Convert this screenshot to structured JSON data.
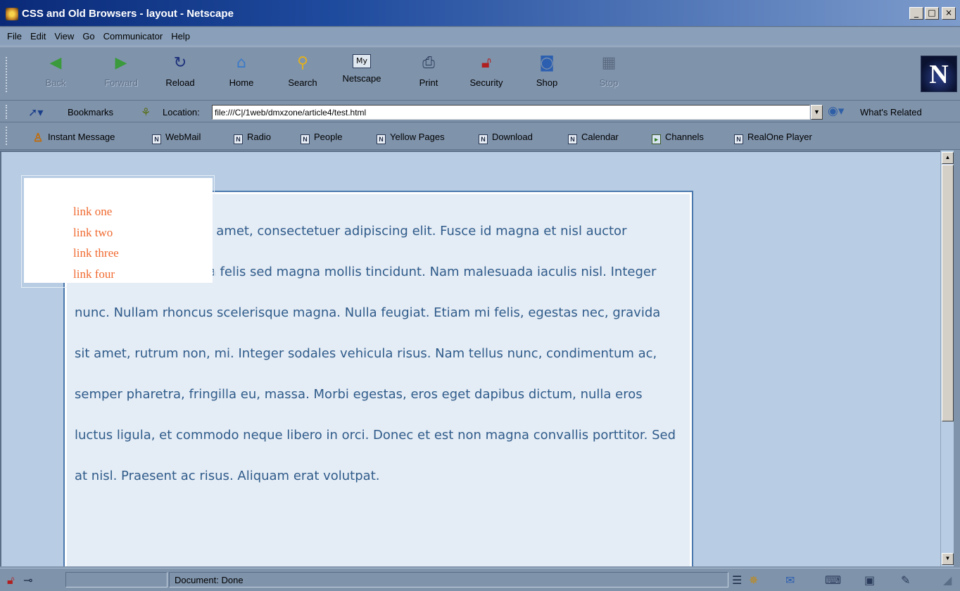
{
  "window": {
    "title": "CSS and Old Browsers - layout - Netscape",
    "controls": {
      "minimize": "_",
      "maximize": "□",
      "close": "×"
    }
  },
  "menu": [
    "File",
    "Edit",
    "View",
    "Go",
    "Communicator",
    "Help"
  ],
  "navigation": {
    "buttons": [
      {
        "label": "Back",
        "icon": "back-arrow-icon",
        "enabled": false
      },
      {
        "label": "Forward",
        "icon": "forward-arrow-icon",
        "enabled": false
      },
      {
        "label": "Reload",
        "icon": "reload-icon",
        "enabled": true
      },
      {
        "label": "Home",
        "icon": "home-icon",
        "enabled": true
      },
      {
        "label": "Search",
        "icon": "search-icon",
        "enabled": true
      },
      {
        "label": "Netscape",
        "icon": "my-netscape-icon",
        "enabled": true
      },
      {
        "label": "Print",
        "icon": "print-icon",
        "enabled": true
      },
      {
        "label": "Security",
        "icon": "security-lock-icon",
        "enabled": true
      },
      {
        "label": "Shop",
        "icon": "shop-icon",
        "enabled": true
      },
      {
        "label": "Stop",
        "icon": "stop-icon",
        "enabled": false
      }
    ],
    "logo": "N"
  },
  "location": {
    "bookmarks_label": "Bookmarks",
    "location_label": "Location:",
    "url": "file:///C|/1web/dmxzone/article4/test.html",
    "related_label": "What's Related"
  },
  "personal_toolbar": [
    {
      "label": "Instant Message",
      "icon": "instant-message-icon"
    },
    {
      "label": "WebMail",
      "icon": "bookmark-page-icon"
    },
    {
      "label": "Radio",
      "icon": "bookmark-page-icon"
    },
    {
      "label": "People",
      "icon": "bookmark-page-icon"
    },
    {
      "label": "Yellow Pages",
      "icon": "bookmark-page-icon"
    },
    {
      "label": "Download",
      "icon": "bookmark-page-icon"
    },
    {
      "label": "Calendar",
      "icon": "bookmark-page-icon"
    },
    {
      "label": "Channels",
      "icon": "channels-icon"
    },
    {
      "label": "RealOne Player",
      "icon": "bookmark-page-icon"
    }
  ],
  "page": {
    "nav_links": [
      "link one",
      "link two",
      "link three",
      "link four"
    ],
    "paragraph": "Lorem ipsum dolor sit amet, consectetuer adipiscing elit. Fusce id magna et nisl auctor malesuada. Aliquam a felis sed magna mollis tincidunt. Nam malesuada iaculis nisl. Integer nunc. Nullam rhoncus scelerisque magna. Nulla feugiat. Etiam mi felis, egestas nec, gravida sit amet, rutrum non, mi. Integer sodales vehicula risus. Nam tellus nunc, condimentum ac, semper pharetra, fringilla eu, massa. Morbi egestas, eros eget dapibus dictum, nulla eros luctus ligula, et commodo neque libero in orci. Donec et est non magna convallis porttitor. Sed at nisl. Praesent ac risus. Aliquam erat volutpat.",
    "link_color": "#f06a30",
    "text_color": "#2f5b8a"
  },
  "status": {
    "text": "Document: Done"
  },
  "colors": {
    "chrome": "#7f93ab",
    "content_bg": "#b8cde3",
    "box_bg": "#e4ecf5",
    "box_border": "#4a78ad"
  }
}
